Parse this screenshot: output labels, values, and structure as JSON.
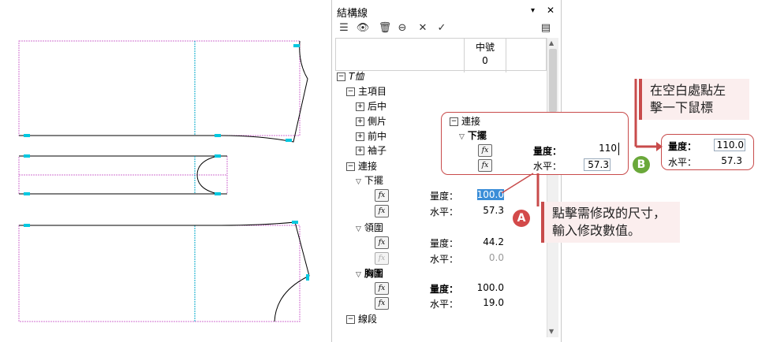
{
  "panel": {
    "title": "結構線",
    "toolbar": [
      "☰",
      "👁",
      "🗑",
      "⊖",
      "✕",
      "✓"
    ],
    "close": "✕",
    "column_header": {
      "size_name": "中號",
      "size_num": "0"
    }
  },
  "tree": {
    "root": "T恤",
    "main_items": "主項目",
    "items": [
      "后中",
      "側片",
      "前中",
      "袖子"
    ],
    "connect": "連接",
    "hem": "下擺",
    "neck": "領圍",
    "chest": "胸圍",
    "segment": "線段",
    "measure_label": "量度：",
    "horizontal_label": "水平：",
    "hem_measure": "100.0",
    "hem_horizontal": "57.3",
    "neck_measure": "44.2",
    "neck_horizontal": "0.0",
    "chest_measure": "100.0",
    "chest_horizontal": "19.0"
  },
  "callout_edit": {
    "connect": "連接",
    "hem": "下擺",
    "measure_label": "量度：",
    "measure_value": "110",
    "horizontal_label": "水平：",
    "horizontal_value": "57.3"
  },
  "callout_result": {
    "measure_label": "量度：",
    "measure_value": "110.0",
    "horizontal_label": "水平：",
    "horizontal_value": "57.3"
  },
  "note_a": "點擊需修改的尺寸，\n輸入修改數值。",
  "note_b": "在空白處點左\n擊一下鼠標",
  "badge_a": "A",
  "badge_b": "B",
  "colors": {
    "accent": "#c84b4b",
    "pattern_cyan": "#00c8e0",
    "pattern_pink": "#d070d0",
    "selection": "#3b8ed8"
  }
}
